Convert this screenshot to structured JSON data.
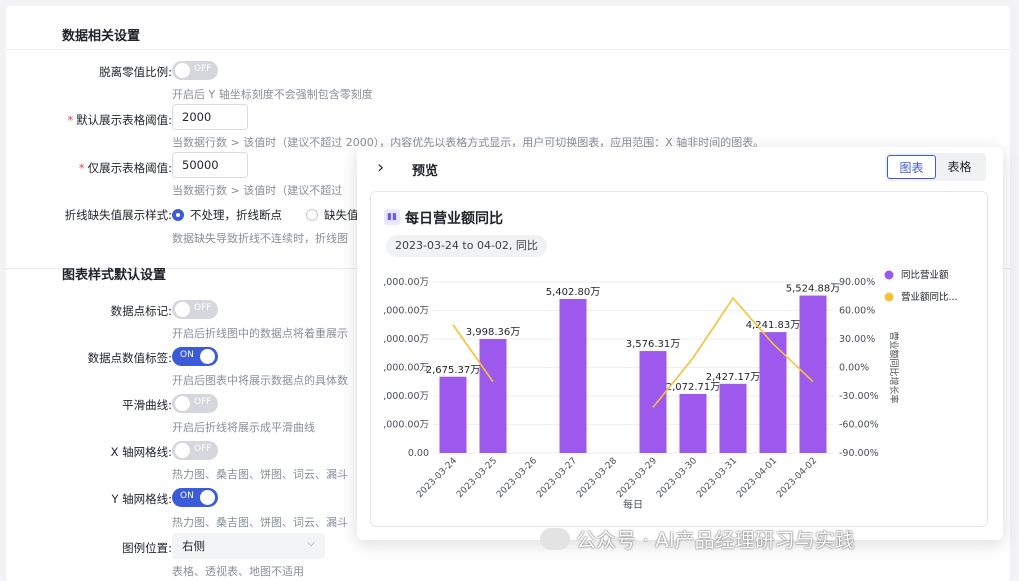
{
  "settings": {
    "data_section_title": "数据相关设置",
    "style_section_title": "图表样式默认设置",
    "zero_ratio": {
      "label": "脱离零值比例:",
      "switch": "OFF",
      "hint": "开启后 Y 轴坐标刻度不会强制包含零刻度"
    },
    "table_threshold": {
      "label": "默认展示表格阈值:",
      "value": "2000",
      "hint": "当数据行数 > 该值时（建议不超过 2000），内容优先以表格方式显示，用户可切换图表，应用范围：X 轴非时间的图表。"
    },
    "only_table_threshold": {
      "label": "仅展示表格阈值:",
      "value": "50000",
      "hint": "当数据行数 > 该值时（建议不超过"
    },
    "missing_style": {
      "label": "折线缺失值展示样式:",
      "option1": "不处理，折线断点",
      "option2": "缺失值",
      "hint": "数据缺失导致折线不连续时，折线图"
    },
    "point_marker": {
      "label": "数据点标记:",
      "switch": "OFF",
      "hint": "开启后折线图中的数据点将着重展示"
    },
    "point_label": {
      "label": "数据点数值标签:",
      "switch": "ON",
      "hint": "开启后图表中将展示数据点的具体数"
    },
    "smooth": {
      "label": "平滑曲线:",
      "switch": "OFF",
      "hint": "开启后折线将展示成平滑曲线"
    },
    "x_grid": {
      "label": "X 轴网格线:",
      "switch": "OFF",
      "hint": "热力图、桑吉图、饼图、词云、漏斗"
    },
    "y_grid": {
      "label": "Y 轴网格线:",
      "switch": "ON",
      "hint": "热力图、桑吉图、饼图、词云、漏斗"
    },
    "legend_pos": {
      "label": "图例位置:",
      "value": "右侧",
      "hint": "表格、透视表、地图不适用"
    }
  },
  "preview": {
    "back_icon": "chevron-right-icon",
    "title": "预览",
    "tab_chart": "图表",
    "tab_table": "表格",
    "card_title": "每日营业额同比",
    "date_range": "2023-03-24 to 04-02, 同比"
  },
  "watermark": "公众号 · AI产品经理研习与实践",
  "colors": {
    "bar": "#9d58ee",
    "line": "#f7c23a",
    "accent": "#3b5bdb"
  },
  "chart_data": {
    "type": "bar",
    "xlabel": "每日",
    "y2label": "营业额同比增长率",
    "categories": [
      "2023-03-24",
      "2023-03-25",
      "2023-03-26",
      "2023-03-27",
      "2023-03-28",
      "2023-03-29",
      "2023-03-30",
      "2023-03-31",
      "2023-04-01",
      "2023-04-02"
    ],
    "y_ticks": [
      ",000.00万",
      ",000.00万",
      ",000.00万",
      ",000.00万",
      ",000.00万",
      ",000.00万",
      "0.00"
    ],
    "y2_ticks": [
      "90.00%",
      "60.00%",
      "30.00%",
      "0.00%",
      "-30.00%",
      "-60.00%",
      "-90.00%"
    ],
    "ylim": [
      0,
      6000
    ],
    "y2lim": [
      -90,
      90
    ],
    "series": [
      {
        "name": "同比营业额",
        "kind": "bar",
        "values": [
          2675.37,
          3998.36,
          null,
          5402.8,
          null,
          3576.31,
          2072.71,
          2427.17,
          4241.83,
          5524.88
        ],
        "labels": [
          "2,675.37万",
          "3,998.36万",
          "",
          "5,402.80万",
          "",
          "3,576.31万",
          "2,072.71万",
          "2,427.17万",
          "4,241.83万",
          "5,524.88万"
        ]
      },
      {
        "name": "营业额同比...",
        "kind": "line",
        "values": [
          45,
          -15,
          null,
          null,
          null,
          -42,
          10,
          73,
          25,
          -15
        ]
      }
    ]
  }
}
